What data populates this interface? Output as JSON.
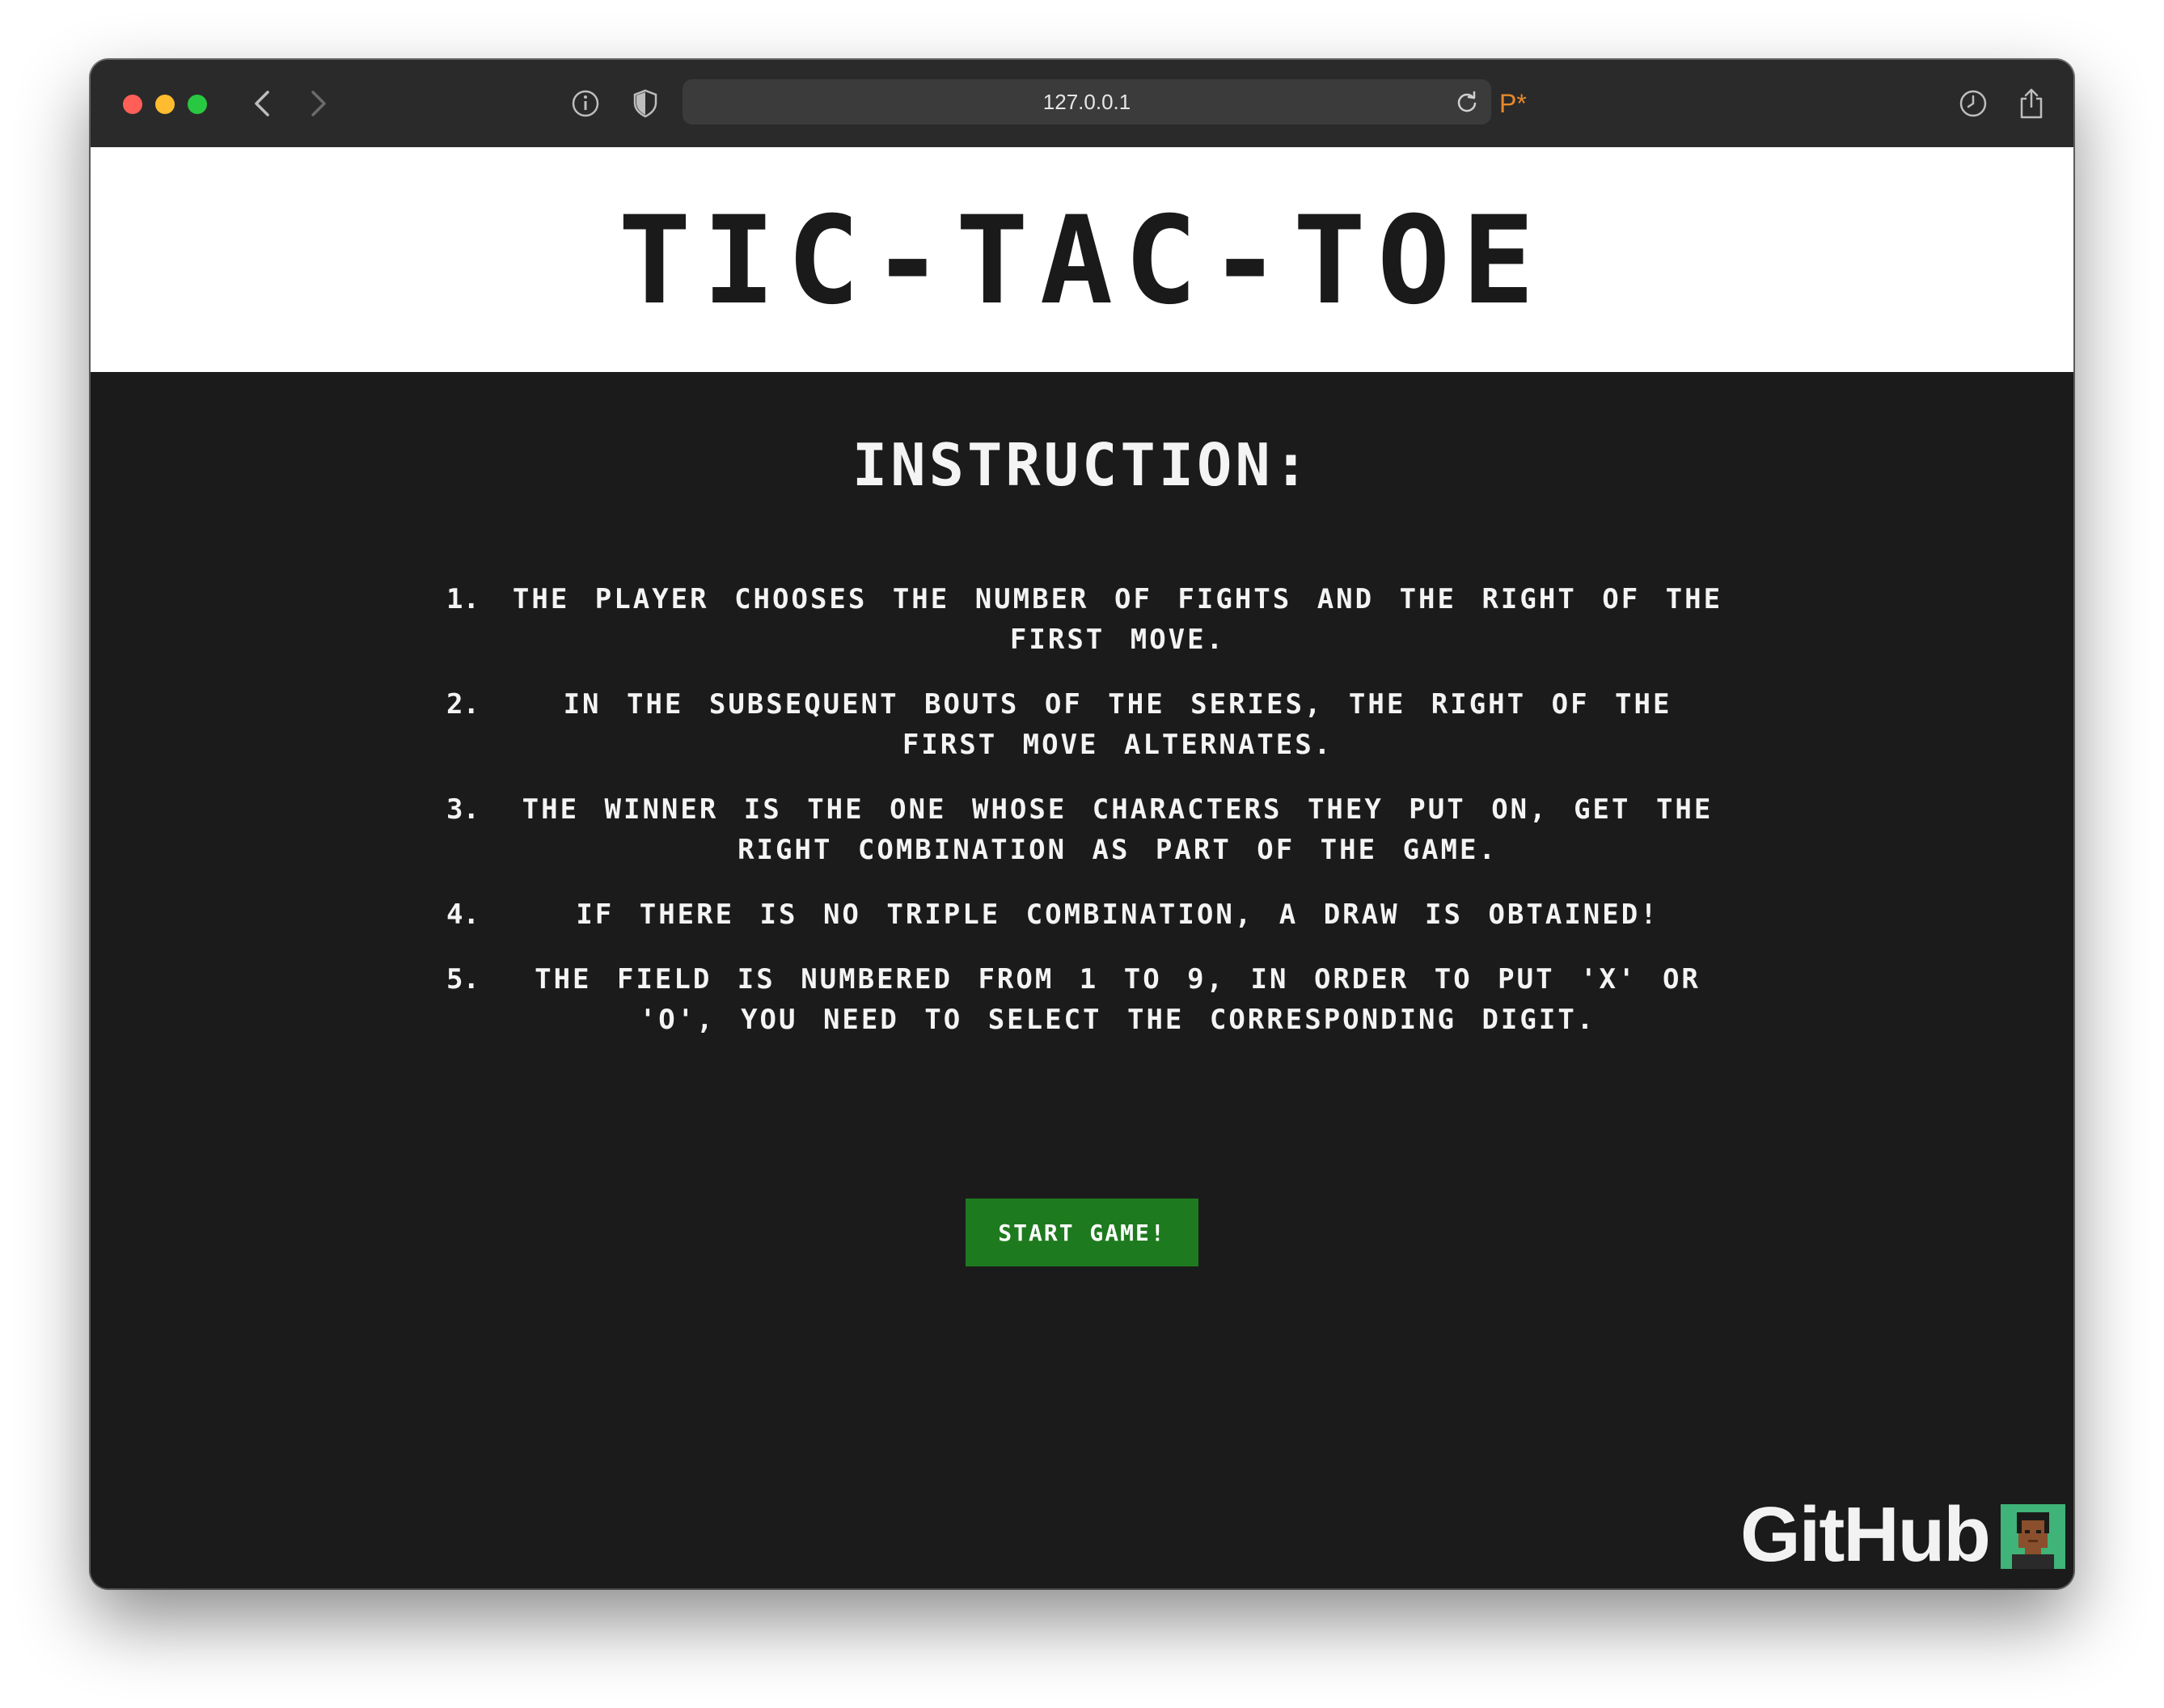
{
  "browser": {
    "url": "127.0.0.1",
    "extension_icon_text": "P*",
    "icons": [
      "back-icon",
      "forward-icon",
      "info-icon",
      "shield-icon",
      "reload-icon",
      "history-icon",
      "share-icon"
    ]
  },
  "header": {
    "title": "TIC-TAC-TOE"
  },
  "instructions": {
    "heading": "INSTRUCTION:",
    "items": [
      {
        "num": "1.",
        "text": "THE PLAYER CHOOSES THE NUMBER OF FIGHTS AND THE RIGHT OF THE FIRST MOVE."
      },
      {
        "num": "2.",
        "text": "IN THE SUBSEQUENT BOUTS OF THE SERIES, THE RIGHT OF THE FIRST MOVE ALTERNATES."
      },
      {
        "num": "3.",
        "text": "THE WINNER IS THE ONE WHOSE CHARACTERS THEY PUT ON, GET THE RIGHT COMBINATION AS PART OF THE GAME."
      },
      {
        "num": "4.",
        "text": "IF THERE IS NO TRIPLE COMBINATION, A DRAW IS OBTAINED!"
      },
      {
        "num": "5.",
        "text": "THE FIELD IS NUMBERED FROM 1 TO 9, IN ORDER TO PUT 'X' OR 'O', YOU NEED TO SELECT THE CORRESPONDING DIGIT."
      }
    ]
  },
  "start_button": {
    "label": "START GAME!",
    "color": "#1e7a1e"
  },
  "footer": {
    "github_label": "GitHub",
    "avatar_bg": "#3fb378"
  }
}
